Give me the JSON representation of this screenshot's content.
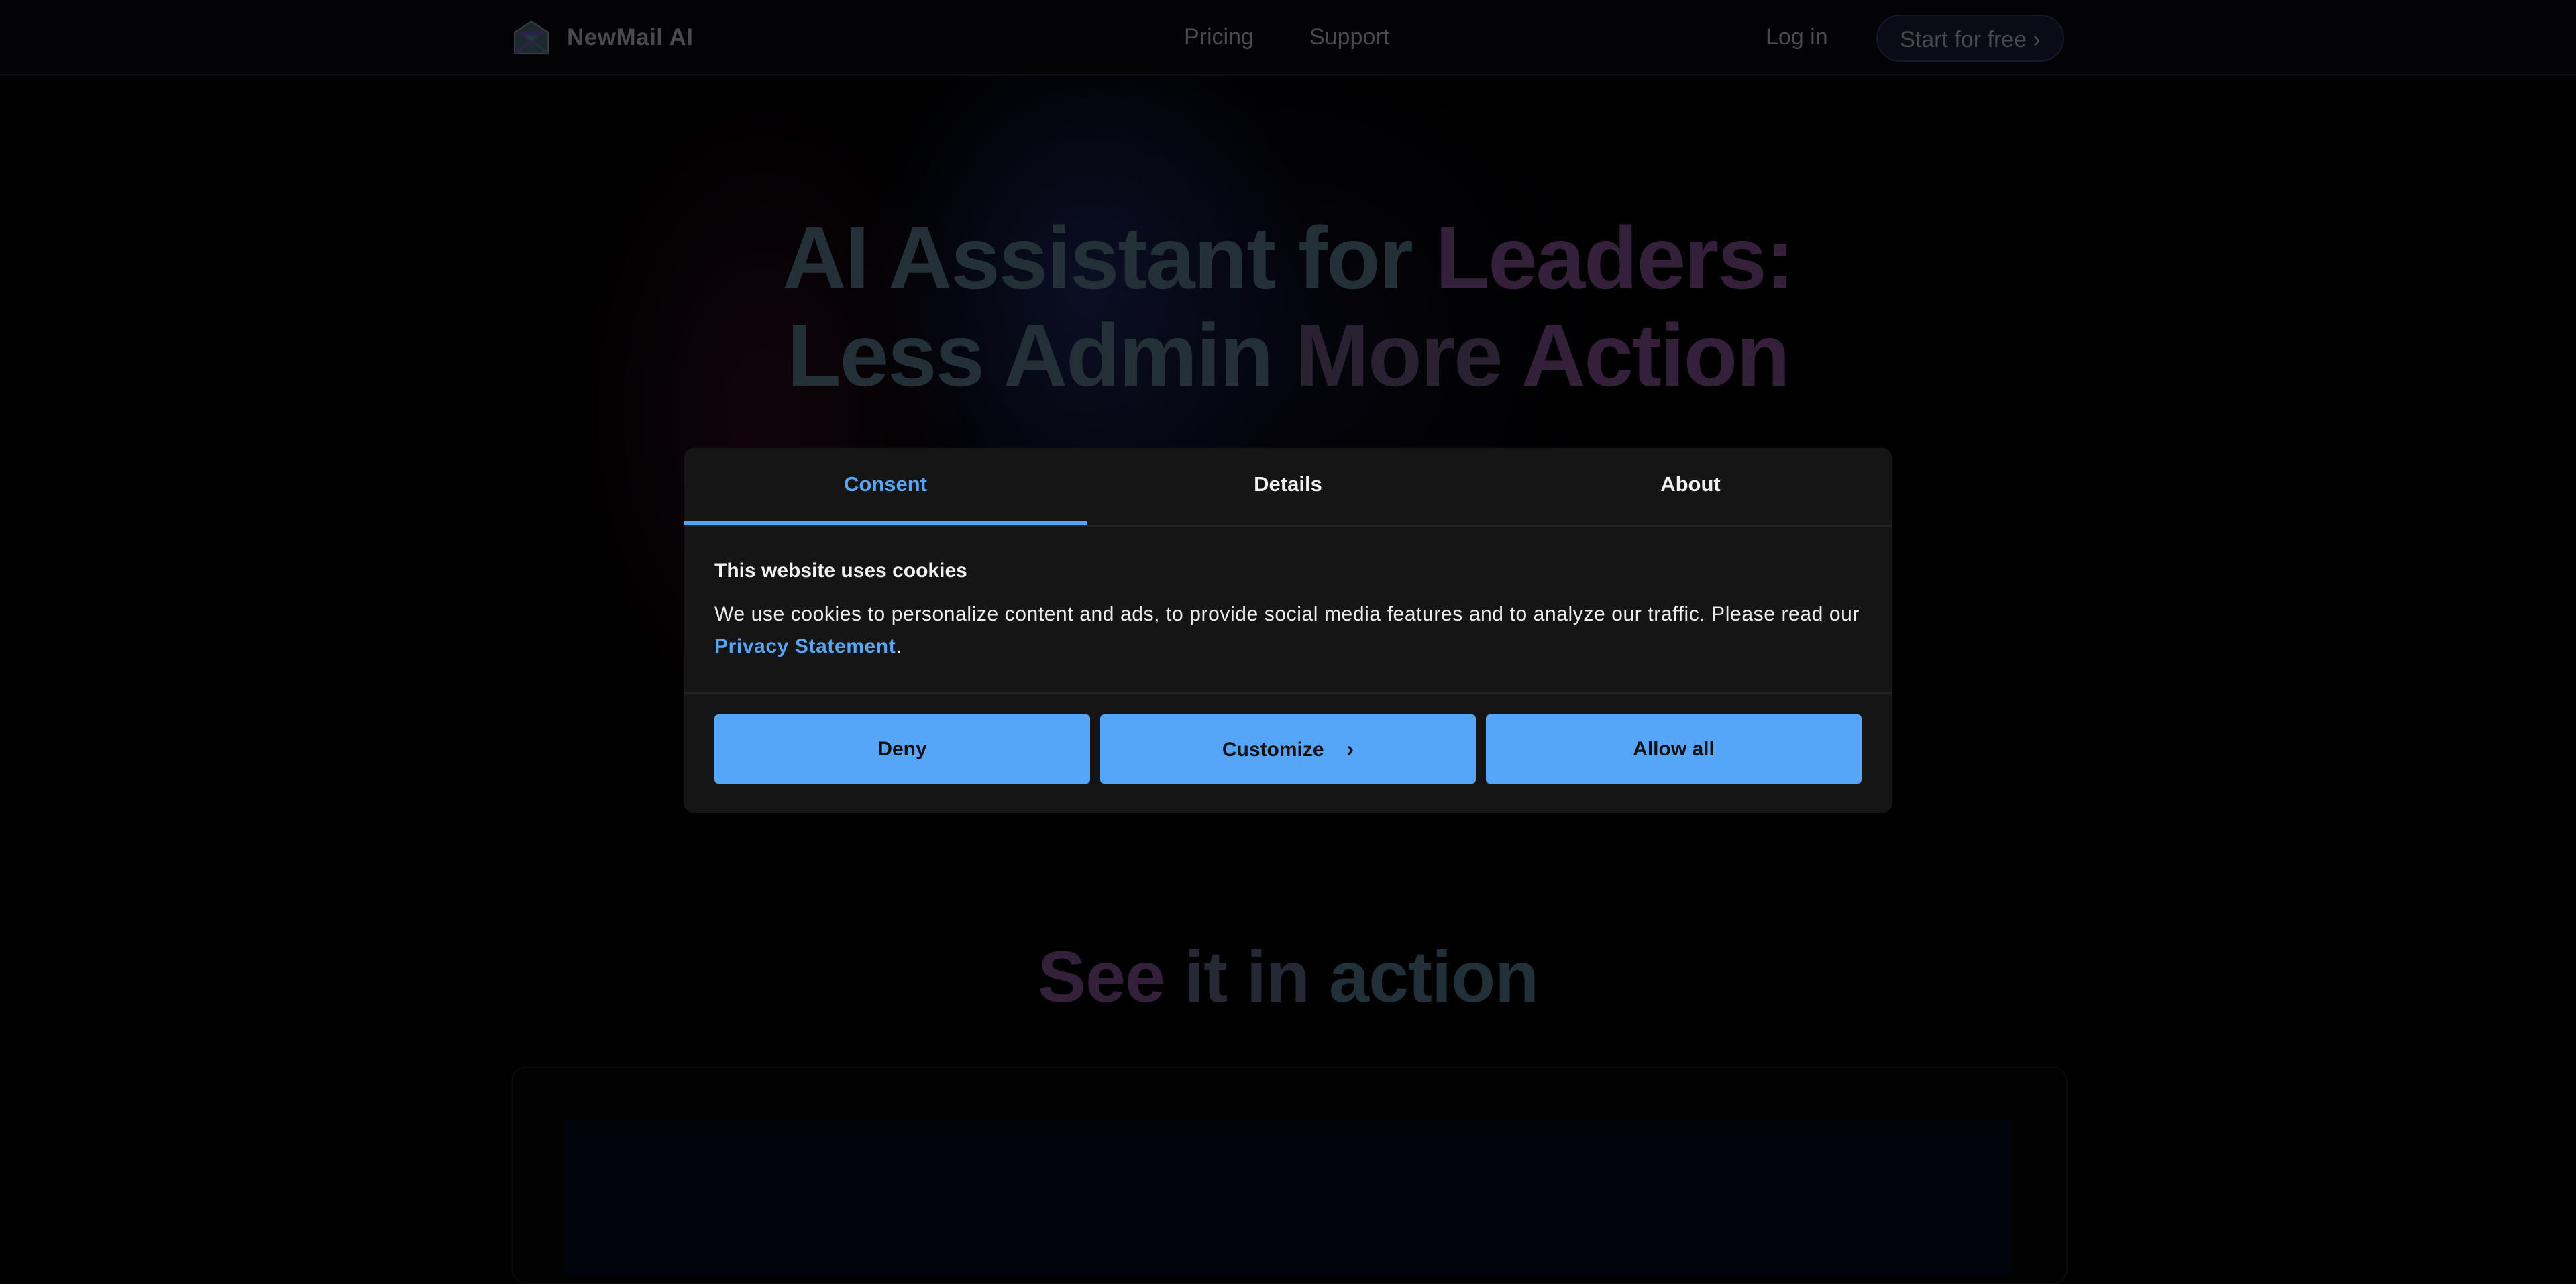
{
  "header": {
    "brand": "NewMail AI",
    "logo_icon": "envelope-logo-icon",
    "nav": [
      {
        "label": "Pricing"
      },
      {
        "label": "Support"
      }
    ],
    "login_label": "Log in",
    "cta_label": "Start for free ›"
  },
  "hero": {
    "title_line1_part1": "AI Assistant for ",
    "title_line1_part2": "Leaders:",
    "title_line2_part1": "Less Admin ",
    "title_line2_part2": "More ",
    "title_line2_part3": "Action"
  },
  "section": {
    "title_part1": "See ",
    "title_part2": "it in ",
    "title_part3": "action"
  },
  "cookie_modal": {
    "tabs": [
      {
        "label": "Consent",
        "active": true
      },
      {
        "label": "Details",
        "active": false
      },
      {
        "label": "About",
        "active": false
      }
    ],
    "title": "This website uses cookies",
    "text_before_link": "We use cookies to personalize content and ads, to provide social media features and to analyze our traffic. Please read our ",
    "link_label": "Privacy Statement",
    "text_after_link": ".",
    "buttons": {
      "deny": "Deny",
      "customize": "Customize",
      "customize_icon": "chevron-right-icon",
      "allow_all": "Allow all"
    }
  },
  "colors": {
    "accent": "#56a5f7",
    "button_bg": "#55a5f8",
    "modal_bg": "#151515",
    "page_bg": "#000000"
  }
}
